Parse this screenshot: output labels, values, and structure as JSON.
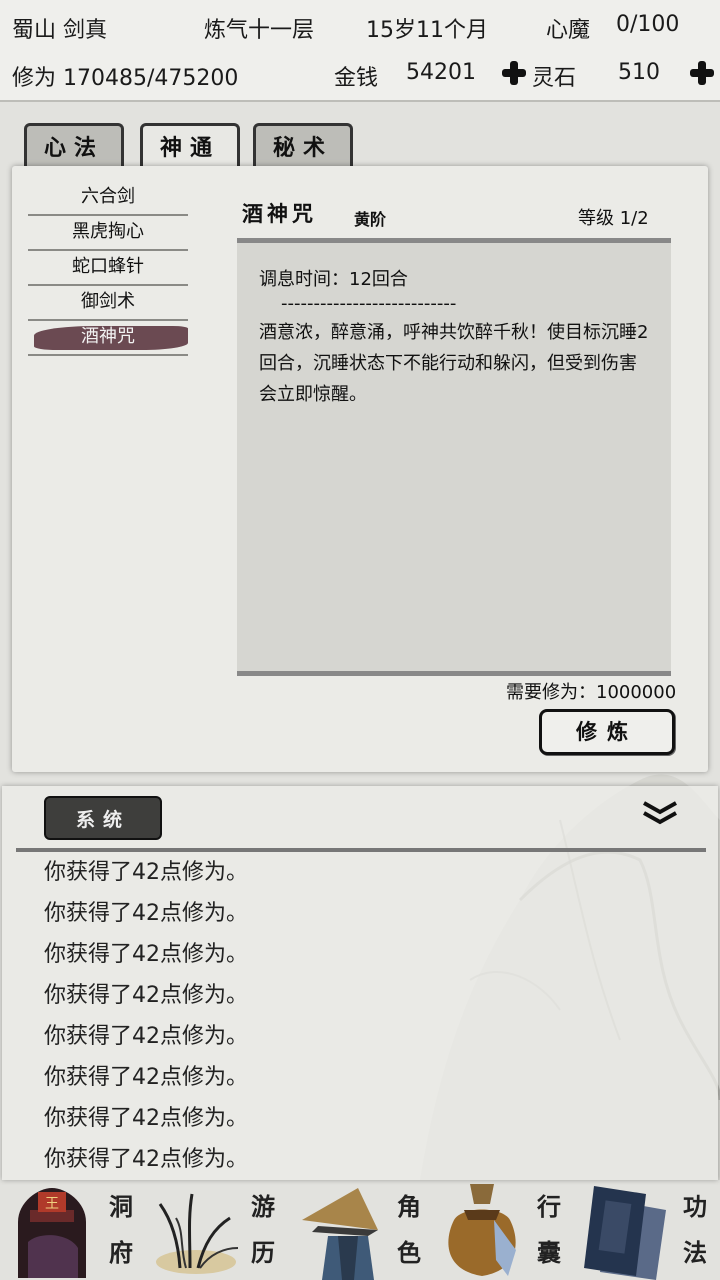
{
  "header": {
    "sect_name": "蜀山 剑真",
    "realm": "炼气十一层",
    "age": "15岁11个月",
    "heart_demon_label": "心魔",
    "heart_demon_value": "0/100",
    "cultivation": "修为 170485/475200",
    "money_label": "金钱",
    "money_value": "54201",
    "spirit_stone_label": "灵石",
    "spirit_stone_value": "510"
  },
  "tabs": [
    {
      "label": "心法"
    },
    {
      "label": "神通"
    },
    {
      "label": "秘术"
    }
  ],
  "skills": [
    {
      "label": "六合剑"
    },
    {
      "label": "黑虎掏心"
    },
    {
      "label": "蛇口蜂针"
    },
    {
      "label": "御剑术"
    },
    {
      "label": "酒神咒"
    }
  ],
  "detail": {
    "name": "酒神咒",
    "rank": "黄阶",
    "level": "等级   1/2",
    "cooldown": "调息时间：12回合",
    "divider": "---------------------------",
    "description": "酒意浓，醉意涌，呼神共饮醉千秋！使目标沉睡2回合，沉睡状态下不能行动和躲闪，但受到伤害会立即惊醒。",
    "requirement": "需要修为：1000000",
    "practice_label": "修炼"
  },
  "log": {
    "tab_label": "系统",
    "entries": [
      "你获得了42点修为。",
      "你获得了42点修为。",
      "你获得了42点修为。",
      "你获得了42点修为。",
      "你获得了42点修为。",
      "你获得了42点修为。",
      "你获得了42点修为。",
      "你获得了42点修为。"
    ]
  },
  "nav": [
    {
      "label_top": "洞",
      "label_bottom": "府",
      "icon": "cave-house-icon"
    },
    {
      "label_top": "游",
      "label_bottom": "历",
      "icon": "travel-grass-icon"
    },
    {
      "label_top": "角",
      "label_bottom": "色",
      "icon": "character-hat-icon"
    },
    {
      "label_top": "行",
      "label_bottom": "囊",
      "icon": "bag-icon"
    },
    {
      "label_top": "功",
      "label_bottom": "法",
      "icon": "books-icon"
    }
  ],
  "colors": {
    "selected_skill": "#6b4a52",
    "background": "#e2e2de"
  }
}
